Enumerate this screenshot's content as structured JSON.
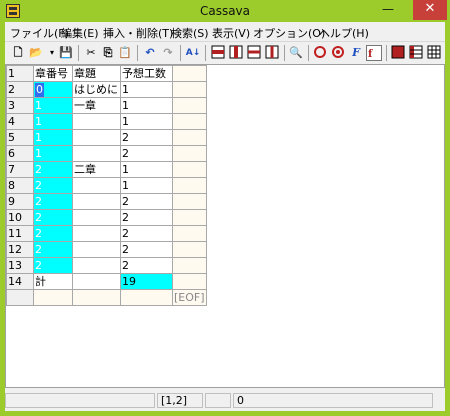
{
  "window": {
    "title": "Cassava",
    "min_glyph": "—",
    "max_glyph": "☐",
    "close_glyph": "✕"
  },
  "menu": [
    "ファイル(F)",
    "編集(E)",
    "挿入・削除(T)",
    "検索(S)",
    "表示(V)",
    "オプション(O)",
    "ヘルプ(H)"
  ],
  "toolbar": {
    "new": "🗋",
    "open": "📂",
    "save": "💾",
    "cut": "✂",
    "copy": "⎘",
    "paste": "📋",
    "undo": "↶",
    "redo": "↷",
    "sort": "A↓",
    "find": "🔍",
    "font": "F"
  },
  "grid": {
    "header_row": [
      "1",
      "章番号",
      "章題",
      "予想工数"
    ],
    "rows": [
      {
        "n": "2",
        "c1": "0",
        "c2": "はじめに",
        "c3": "1"
      },
      {
        "n": "3",
        "c1": "1",
        "c2": "一章",
        "c3": "1"
      },
      {
        "n": "4",
        "c1": "1",
        "c2": "",
        "c3": "1"
      },
      {
        "n": "5",
        "c1": "1",
        "c2": "",
        "c3": "2"
      },
      {
        "n": "6",
        "c1": "1",
        "c2": "",
        "c3": "2"
      },
      {
        "n": "7",
        "c1": "2",
        "c2": "二章",
        "c3": "1"
      },
      {
        "n": "8",
        "c1": "2",
        "c2": "",
        "c3": "1"
      },
      {
        "n": "9",
        "c1": "2",
        "c2": "",
        "c3": "2"
      },
      {
        "n": "10",
        "c1": "2",
        "c2": "",
        "c3": "2"
      },
      {
        "n": "11",
        "c1": "2",
        "c2": "",
        "c3": "2"
      },
      {
        "n": "12",
        "c1": "2",
        "c2": "",
        "c3": "2"
      },
      {
        "n": "13",
        "c1": "2",
        "c2": "",
        "c3": "2"
      }
    ],
    "total_row": {
      "n": "14",
      "c1": "計",
      "c2": "",
      "c3": "19"
    },
    "eof_label": "[EOF]"
  },
  "status": {
    "pane1": "",
    "position": "[1,2]",
    "count": "0"
  },
  "colors": {
    "highlight": "#00ffff",
    "selection": "#3070f0",
    "frame": "#9ccc2c"
  }
}
